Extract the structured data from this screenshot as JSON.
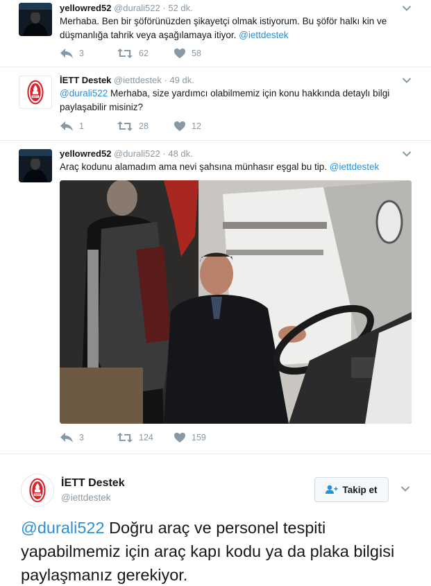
{
  "tweets": [
    {
      "display_name": "yellowred52",
      "screen_name": "@durali522",
      "separator": "·",
      "time": "52 dk.",
      "text": "Merhaba. Ben bir şöförünüzden şikayetçi olmak istiyorum. Bu şöför halkı kin ve düşmanlığa tahrik veya aşağılamaya itiyor.",
      "trailing_mention": "@iettdestek",
      "replies": "3",
      "retweets": "62",
      "likes": "58"
    },
    {
      "display_name": "İETT Destek",
      "screen_name": "@iettdestek",
      "separator": "·",
      "time": "49 dk.",
      "leading_mention": "@durali522",
      "text": "Merhaba, size yardımcı olabilmemiz için konu hakkında detaylı bilgi paylaşabilir misiniz?",
      "replies": "1",
      "retweets": "28",
      "likes": "12"
    },
    {
      "display_name": "yellowred52",
      "screen_name": "@durali522",
      "separator": "·",
      "time": "48 dk.",
      "text": "Araç kodunu alamadım ama nevi şahsına münhasır eşgal bu tip.",
      "trailing_mention": "@iettdestek",
      "replies": "3",
      "retweets": "124",
      "likes": "159"
    }
  ],
  "expanded_tweet": {
    "display_name": "İETT Destek",
    "screen_name": "@iettdestek",
    "follow_label": "Takip et",
    "mention": "@durali522",
    "text": "Doğru araç ve personel tespiti yapabilmemiz için araç kapı kodu ya da plaka bilgisi paylaşmanız gerekiyor."
  },
  "colors": {
    "link": "#2a8fd6",
    "muted": "#8899a6",
    "divider": "#e6ecf0",
    "iett_red": "#d9232e"
  },
  "icons": [
    "reply-icon",
    "retweet-icon",
    "like-icon",
    "chevron-down-icon",
    "follow-user-icon",
    "iett-logo"
  ]
}
